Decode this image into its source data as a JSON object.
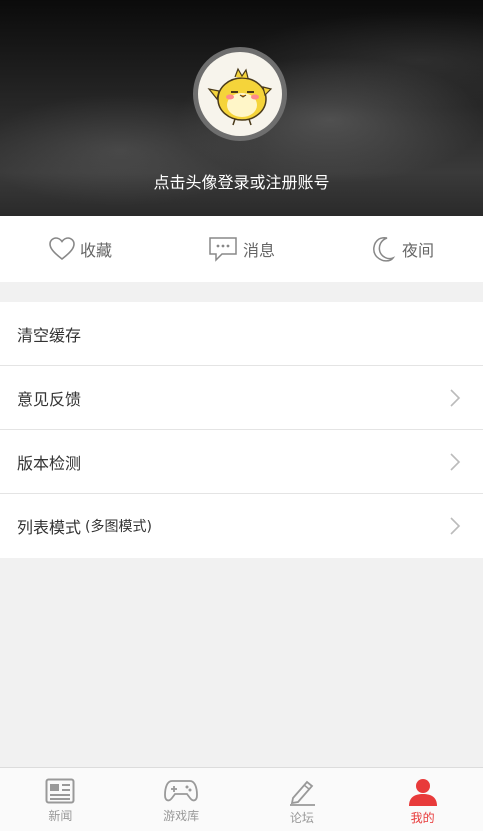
{
  "header": {
    "login_prompt": "点击头像登录或注册账号"
  },
  "quick_actions": [
    {
      "label": "收藏",
      "icon": "heart-icon"
    },
    {
      "label": "消息",
      "icon": "message-icon"
    },
    {
      "label": "夜间",
      "icon": "moon-icon"
    }
  ],
  "menu": {
    "clear_cache": "清空缓存",
    "feedback": "意见反馈",
    "version_check": "版本检测",
    "list_mode": "列表模式",
    "list_mode_value": "(多图模式)"
  },
  "tabbar": {
    "items": [
      {
        "label": "新闻",
        "icon": "news-icon"
      },
      {
        "label": "游戏库",
        "icon": "gamepad-icon"
      },
      {
        "label": "论坛",
        "icon": "pen-icon"
      },
      {
        "label": "我的",
        "icon": "person-icon"
      }
    ],
    "active_index": 3
  },
  "colors": {
    "accent": "#e83a3a",
    "inactive": "#999999",
    "avatar_bird": "#f5d43a"
  }
}
